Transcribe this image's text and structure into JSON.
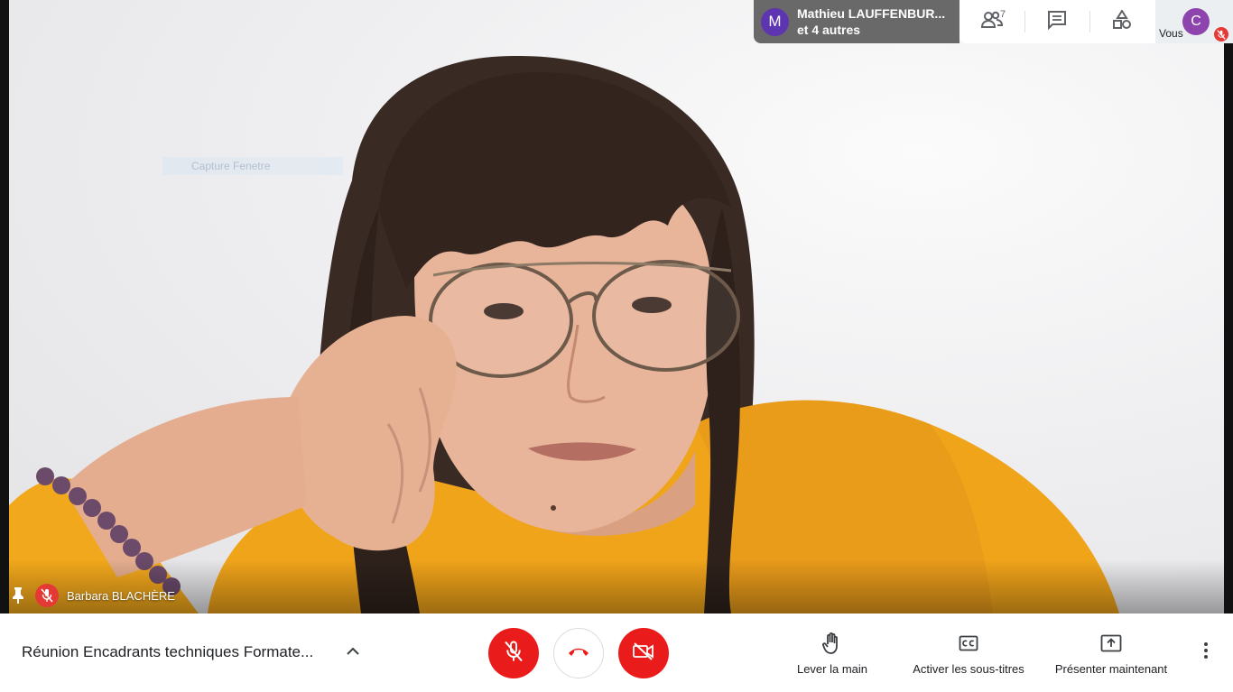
{
  "stage": {
    "ghost_caption": "Capture Fenetre",
    "participant": {
      "name": "Barbara BLACHÈRE",
      "mic_muted": true
    }
  },
  "top_panel": {
    "others": {
      "avatar_letter": "M",
      "line1": "Mathieu LAUFFENBUR...",
      "line2": "et 4 autres"
    },
    "people_count": "7",
    "tools": [
      "people-icon",
      "chat-icon",
      "activities-icon"
    ],
    "self": {
      "avatar_letter": "C",
      "label": "Vous",
      "mic_muted": true
    }
  },
  "bottom_bar": {
    "meeting_title": "Réunion Encadrants techniques Formate...",
    "controls": [
      "mic-off-icon",
      "hang-up-icon",
      "camera-off-icon"
    ],
    "actions": [
      {
        "icon": "raise-hand-icon",
        "label": "Lever la main"
      },
      {
        "icon": "captions-icon",
        "label": "Activer les sous-titres"
      },
      {
        "icon": "present-icon",
        "label": "Présenter maintenant"
      }
    ],
    "more_icon": "more-vert-icon"
  },
  "colors": {
    "danger": "#ea1b1b",
    "avatar_m": "#5e35b1",
    "avatar_c": "#8e44ad",
    "sweater": "#f0a41a"
  }
}
